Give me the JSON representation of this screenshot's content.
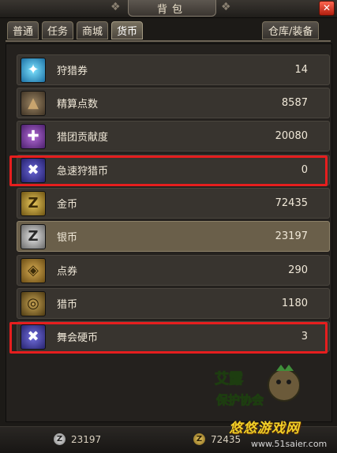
{
  "window": {
    "title": "背包",
    "close_label": "✕"
  },
  "tabs": [
    {
      "label": "普通",
      "active": false
    },
    {
      "label": "任务",
      "active": false
    },
    {
      "label": "商城",
      "active": false
    },
    {
      "label": "货币",
      "active": true
    }
  ],
  "warehouse_tab": {
    "label": "仓库/装备"
  },
  "currencies": [
    {
      "name": "狩猎券",
      "value": "14",
      "icon": "hunt-ticket-icon",
      "glyph": "✦"
    },
    {
      "name": "精算点数",
      "value": "8587",
      "icon": "poop-points-icon",
      "glyph": "▲"
    },
    {
      "name": "猎团贡献度",
      "value": "20080",
      "icon": "guild-contribution-icon",
      "glyph": "✚"
    },
    {
      "name": "急速狩猎币",
      "value": "0",
      "icon": "quick-hunt-coin-icon",
      "glyph": "✖",
      "highlighted": true
    },
    {
      "name": "金币",
      "value": "72435",
      "icon": "gold-coin-icon",
      "glyph": "Z"
    },
    {
      "name": "银币",
      "value": "23197",
      "icon": "silver-coin-icon",
      "glyph": "Z",
      "selected": true
    },
    {
      "name": "点券",
      "value": "290",
      "icon": "point-ticket-icon",
      "glyph": "◈"
    },
    {
      "name": "猎币",
      "value": "1180",
      "icon": "hunter-coin-icon",
      "glyph": "◎"
    },
    {
      "name": "舞会硬币",
      "value": "3",
      "icon": "dance-coin-icon",
      "glyph": "✖",
      "highlighted": true
    }
  ],
  "footer": {
    "silver_value": "23197",
    "gold_value": "72435",
    "silver_glyph": "Z",
    "gold_glyph": "Z"
  },
  "watermark": {
    "logo_text": "艾露保护协会",
    "site_name": "悠悠游戏网",
    "url": "www.51saier.com"
  },
  "colors": {
    "highlight": "#e61e1e",
    "selected_row": "#6a5f4a",
    "row": "#38342f"
  }
}
